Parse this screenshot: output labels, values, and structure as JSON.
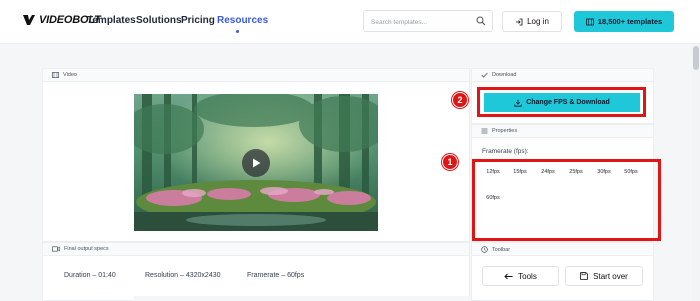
{
  "nav": {
    "logo_text": "VIDEOBOLT",
    "links": [
      "Templates",
      "Solutions",
      "Pricing",
      "Resources"
    ],
    "active_link": "Resources",
    "search_placeholder": "Search templates...",
    "login_label": "Log in",
    "templates_button_label": "18,500+ templates"
  },
  "video_panel": {
    "header": "Video",
    "icon": "film-icon"
  },
  "specs": {
    "header": "Final output specs",
    "duration": "Duration – 01:40",
    "resolution": "Resolution – 4320x2430",
    "framerate": "Framerate – 60fps"
  },
  "download_panel": {
    "header": "Download",
    "button_label": "Change FPS & Download"
  },
  "properties_panel": {
    "header": "Properties",
    "framerate_label": "Framerate (fps):",
    "fps_options": [
      "12fps",
      "15fps",
      "24fps",
      "25fps",
      "30fps",
      "50fps",
      "60fps"
    ]
  },
  "toolbar_panel": {
    "header": "Toolbar",
    "tools_label": "Tools",
    "start_over_label": "Start over"
  },
  "annotations": {
    "badge_1": "1",
    "badge_2": "2",
    "highlight_color": "#e01515"
  },
  "colors": {
    "accent": "#1fc8d8",
    "active_link": "#3b5bdb"
  }
}
